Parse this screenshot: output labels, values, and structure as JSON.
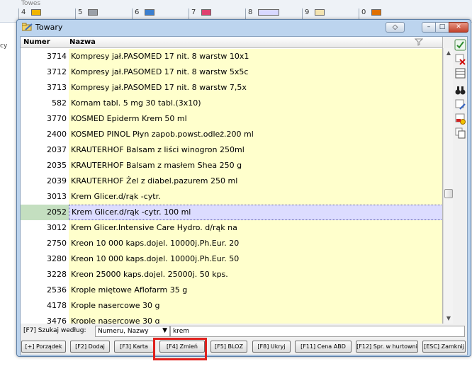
{
  "background": {
    "top_text": "Towes",
    "cells": [
      "4",
      "5",
      "6",
      "7",
      "8",
      "9",
      "0"
    ],
    "left_text": "cy"
  },
  "window": {
    "title": "Towary",
    "titlebar_icon": "folder-pencil-icon",
    "close_glyph": "✕",
    "min_glyph": "–",
    "max_glyph": "□",
    "extra_glyph": "◇"
  },
  "grid": {
    "columns": [
      "Numer",
      "Nazwa"
    ],
    "rows": [
      {
        "numer": "3714",
        "nazwa": "Kompresy jał.PASOMED 17 nit. 8 warstw 10x1",
        "selected": false
      },
      {
        "numer": "3712",
        "nazwa": "Kompresy jał.PASOMED 17 nit. 8 warstw 5x5c",
        "selected": false
      },
      {
        "numer": "3713",
        "nazwa": "Kompresy jał.PASOMED 17 nit. 8 warstw 7,5x",
        "selected": false
      },
      {
        "numer": "582",
        "nazwa": "Kornam tabl. 5 mg 30 tabl.(3x10)",
        "selected": false
      },
      {
        "numer": "3770",
        "nazwa": "KOSMED Epiderm Krem 50 ml",
        "selected": false
      },
      {
        "numer": "2400",
        "nazwa": "KOSMED PINOL Płyn zapob.powst.odleż.200 ml",
        "selected": false
      },
      {
        "numer": "2037",
        "nazwa": "KRAUTERHOF Balsam z liści winogron 250ml",
        "selected": false
      },
      {
        "numer": "2035",
        "nazwa": "KRAUTERHOF Balsam z masłem Shea 250 g",
        "selected": false
      },
      {
        "numer": "2039",
        "nazwa": "KRAUTERHOF Żel z diabel.pazurem 250 ml",
        "selected": false
      },
      {
        "numer": "3013",
        "nazwa": "Krem Glicer.d/rąk -cytr.",
        "selected": false
      },
      {
        "numer": "2052",
        "nazwa": "Krem Glicer.d/rąk -cytr. 100 ml",
        "selected": true
      },
      {
        "numer": "3012",
        "nazwa": "Krem Glicer.Intensive Care Hydro. d/rąk na",
        "selected": false
      },
      {
        "numer": "2750",
        "nazwa": "Kreon 10 000 kaps.dojel. 10000j.Ph.Eur. 20",
        "selected": false
      },
      {
        "numer": "3280",
        "nazwa": "Kreon 10 000 kaps.dojel. 10000j.Ph.Eur. 50",
        "selected": false
      },
      {
        "numer": "3228",
        "nazwa": "Kreon 25000 kaps.dojel. 25000j. 50 kps.",
        "selected": false
      },
      {
        "numer": "2536",
        "nazwa": "Krople miętowe Aflofarm 35 g",
        "selected": false
      },
      {
        "numer": "4178",
        "nazwa": "Krople nasercowe 30 g",
        "selected": false
      },
      {
        "numer": "3476",
        "nazwa": "Krople nasercowe 30 g",
        "selected": false
      },
      {
        "numer": "2923",
        "nazwa": "Krople nasercowe Aflofarm 30 g",
        "selected": false
      }
    ]
  },
  "search": {
    "label": "[F7] Szukaj według:",
    "field_option": "Numeru, Nazwy",
    "query": "krem"
  },
  "buttons": [
    {
      "label": "[+] Porządek"
    },
    {
      "label": "[F2] Dodaj"
    },
    {
      "label": "[F3] Karta"
    },
    {
      "label": "[F4] Zmień"
    },
    {
      "label": "[F5] BLOZ"
    },
    {
      "label": "[F8] Ukryj"
    },
    {
      "label": "[F11] Cena ABD"
    },
    {
      "label": "[F12] Spr. w hurtowni"
    },
    {
      "label": "[ESC] Zamknij"
    }
  ],
  "side_toolbar": [
    "check-icon",
    "delete-record-icon",
    "table-icon",
    "binoculars-icon",
    "edit-record-icon",
    "record-color-icon",
    "copy-record-icon"
  ],
  "colors": {
    "accent_highlight": "#e0211d",
    "name_column_bg": "#ffffcc",
    "selected_row_bg": "#dcdcff"
  }
}
